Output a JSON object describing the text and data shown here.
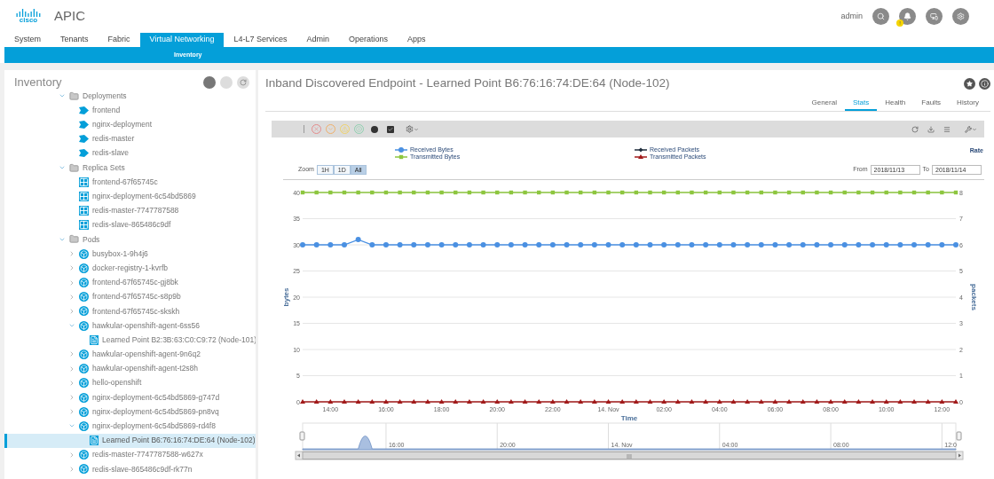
{
  "header": {
    "logo_text": "cisco",
    "app_name": "APIC",
    "user": "admin",
    "notification_badge": "!"
  },
  "tabs": [
    {
      "label": "System",
      "selected": false
    },
    {
      "label": "Tenants",
      "selected": false
    },
    {
      "label": "Fabric",
      "selected": false
    },
    {
      "label": "Virtual Networking",
      "selected": true
    },
    {
      "label": "L4-L7 Services",
      "selected": false
    },
    {
      "label": "Admin",
      "selected": false
    },
    {
      "label": "Operations",
      "selected": false
    },
    {
      "label": "Apps",
      "selected": false
    }
  ],
  "subtabs": [
    {
      "label": "Inventory",
      "selected": true
    }
  ],
  "sidebar": {
    "title": "Inventory",
    "tree": [
      {
        "label": "Deployments",
        "kind": "folder",
        "expanded": true,
        "selected": false,
        "children": [
          {
            "label": "frontend",
            "kind": "deployment",
            "selected": false
          },
          {
            "label": "nginx-deployment",
            "kind": "deployment",
            "selected": false
          },
          {
            "label": "redis-master",
            "kind": "deployment",
            "selected": false
          },
          {
            "label": "redis-slave",
            "kind": "deployment",
            "selected": false
          }
        ]
      },
      {
        "label": "Replica Sets",
        "kind": "folder",
        "expanded": true,
        "selected": false,
        "children": [
          {
            "label": "frontend-67f65745c",
            "kind": "replicaset",
            "selected": false
          },
          {
            "label": "nginx-deployment-6c54bd5869",
            "kind": "replicaset",
            "selected": false
          },
          {
            "label": "redis-master-7747787588",
            "kind": "replicaset",
            "selected": false
          },
          {
            "label": "redis-slave-865486c9df",
            "kind": "replicaset",
            "selected": false
          }
        ]
      },
      {
        "label": "Pods",
        "kind": "folder",
        "expanded": true,
        "selected": false,
        "children": [
          {
            "label": "busybox-1-9h4j6",
            "kind": "pod",
            "expanded": false,
            "selected": false
          },
          {
            "label": "docker-registry-1-kvrfb",
            "kind": "pod",
            "expanded": false,
            "selected": false
          },
          {
            "label": "frontend-67f65745c-gj8bk",
            "kind": "pod",
            "expanded": false,
            "selected": false
          },
          {
            "label": "frontend-67f65745c-s8p9b",
            "kind": "pod",
            "expanded": false,
            "selected": false
          },
          {
            "label": "frontend-67f65745c-skskh",
            "kind": "pod",
            "expanded": false,
            "selected": false
          },
          {
            "label": "hawkular-openshift-agent-6ss56",
            "kind": "pod",
            "expanded": true,
            "selected": false,
            "children": [
              {
                "label": "Learned Point B2:3B:63:C0:C9:72 (Node-101)",
                "kind": "endpoint",
                "selected": false
              }
            ]
          },
          {
            "label": "hawkular-openshift-agent-9n6q2",
            "kind": "pod",
            "expanded": false,
            "selected": false
          },
          {
            "label": "hawkular-openshift-agent-t2s8h",
            "kind": "pod",
            "expanded": false,
            "selected": false
          },
          {
            "label": "hello-openshift",
            "kind": "pod",
            "expanded": false,
            "selected": false
          },
          {
            "label": "nginx-deployment-6c54bd5869-g747d",
            "kind": "pod",
            "expanded": false,
            "selected": false
          },
          {
            "label": "nginx-deployment-6c54bd5869-pn8vq",
            "kind": "pod",
            "expanded": false,
            "selected": false
          },
          {
            "label": "nginx-deployment-6c54bd5869-rd4f8",
            "kind": "pod",
            "expanded": true,
            "selected": false,
            "children": [
              {
                "label": "Learned Point B6:76:16:74:DE:64 (Node-102)",
                "kind": "endpoint",
                "selected": true
              }
            ]
          },
          {
            "label": "redis-master-7747787588-w627x",
            "kind": "pod",
            "expanded": false,
            "selected": false
          },
          {
            "label": "redis-slave-865486c9df-rk77n",
            "kind": "pod",
            "expanded": false,
            "selected": false
          }
        ]
      }
    ]
  },
  "detail": {
    "title": "Inband Discovered Endpoint - Learned Point B6:76:16:74:DE:64 (Node-102)",
    "tabs": [
      {
        "label": "General",
        "selected": false
      },
      {
        "label": "Stats",
        "selected": true
      },
      {
        "label": "Health",
        "selected": false
      },
      {
        "label": "Faults",
        "selected": false
      },
      {
        "label": "History",
        "selected": false
      }
    ],
    "rate_label": "Rate",
    "zoom": {
      "label": "Zoom",
      "options": [
        {
          "label": "1H",
          "selected": false
        },
        {
          "label": "1D",
          "selected": false
        },
        {
          "label": "All",
          "selected": true
        }
      ]
    },
    "from": {
      "label": "From",
      "value": "2018/11/13"
    },
    "to": {
      "label": "To",
      "value": "2018/11/14"
    },
    "chart_data": {
      "type": "line",
      "xlabel": "Time",
      "ylabel": "bytes",
      "x": [
        "2018-11-13 13:00",
        "2018-11-13 13:30",
        "2018-11-13 14:00",
        "2018-11-13 14:30",
        "2018-11-13 15:00",
        "2018-11-13 15:30",
        "2018-11-13 16:00",
        "2018-11-13 16:30",
        "2018-11-13 17:00",
        "2018-11-13 17:30",
        "2018-11-13 18:00",
        "2018-11-13 18:30",
        "2018-11-13 19:00",
        "2018-11-13 19:30",
        "2018-11-13 20:00",
        "2018-11-13 20:30",
        "2018-11-13 21:00",
        "2018-11-13 21:30",
        "2018-11-13 22:00",
        "2018-11-13 22:30",
        "2018-11-13 23:00",
        "2018-11-13 23:30",
        "2018-11-14 00:00",
        "2018-11-14 00:30",
        "2018-11-14 01:00",
        "2018-11-14 01:30",
        "2018-11-14 02:00",
        "2018-11-14 02:30",
        "2018-11-14 03:00",
        "2018-11-14 03:30",
        "2018-11-14 04:00",
        "2018-11-14 04:30",
        "2018-11-14 05:00",
        "2018-11-14 05:30",
        "2018-11-14 06:00",
        "2018-11-14 06:30",
        "2018-11-14 07:00",
        "2018-11-14 07:30",
        "2018-11-14 08:00",
        "2018-11-14 08:30",
        "2018-11-14 09:00",
        "2018-11-14 09:30",
        "2018-11-14 10:00",
        "2018-11-14 10:30",
        "2018-11-14 11:00",
        "2018-11-14 11:30",
        "2018-11-14 12:00",
        "2018-11-14 12:30"
      ],
      "series": [
        {
          "name": "Received Bytes",
          "color": "#4a90e2",
          "marker": "circle",
          "values": [
            30,
            30,
            30,
            30,
            31,
            30,
            30,
            30,
            30,
            30,
            30,
            30,
            30,
            30,
            30,
            30,
            30,
            30,
            30,
            30,
            30,
            30,
            30,
            30,
            30,
            30,
            30,
            30,
            30,
            30,
            30,
            30,
            30,
            30,
            30,
            30,
            30,
            30,
            30,
            30,
            30,
            30,
            30,
            30,
            30,
            30,
            30,
            30
          ]
        },
        {
          "name": "Transmitted Bytes",
          "color": "#8dc63f",
          "marker": "square",
          "values": [
            40,
            40,
            40,
            40,
            40,
            40,
            40,
            40,
            40,
            40,
            40,
            40,
            40,
            40,
            40,
            40,
            40,
            40,
            40,
            40,
            40,
            40,
            40,
            40,
            40,
            40,
            40,
            40,
            40,
            40,
            40,
            40,
            40,
            40,
            40,
            40,
            40,
            40,
            40,
            40,
            40,
            40,
            40,
            40,
            40,
            40,
            40,
            40
          ]
        },
        {
          "name": "Received Packets",
          "color": "#1f2d3d",
          "marker": "diamond",
          "values": [
            null,
            null,
            null,
            null,
            null,
            null,
            null,
            null,
            null,
            null,
            null,
            null,
            null,
            null,
            null,
            null,
            null,
            null,
            null,
            null,
            null,
            null,
            null,
            null,
            null,
            null,
            null,
            null,
            null,
            null,
            null,
            null,
            null,
            null,
            null,
            null,
            null,
            null,
            null,
            null,
            null,
            null,
            null,
            null,
            null,
            null,
            null,
            null
          ]
        },
        {
          "name": "Transmitted Packets",
          "color": "#a11a1a",
          "marker": "triangle",
          "values": [
            0,
            0,
            0,
            0,
            0,
            0,
            0,
            0,
            0,
            0,
            0,
            0,
            0,
            0,
            0,
            0,
            0,
            0,
            0,
            0,
            0,
            0,
            0,
            0,
            0,
            0,
            0,
            0,
            0,
            0,
            0,
            0,
            0,
            0,
            0,
            0,
            0,
            0,
            0,
            0,
            0,
            0,
            0,
            0,
            0,
            0,
            0,
            0
          ]
        }
      ],
      "xlim": [
        "2018-11-13 13:00",
        "2018-11-14 12:30"
      ],
      "ylim": [
        0,
        40
      ],
      "grid": true,
      "xticks": [
        {
          "value": "2018-11-13 14:00",
          "label": "14:00"
        },
        {
          "value": "2018-11-13 16:00",
          "label": "16:00"
        },
        {
          "value": "2018-11-13 18:00",
          "label": "18:00"
        },
        {
          "value": "2018-11-13 20:00",
          "label": "20:00"
        },
        {
          "value": "2018-11-13 22:00",
          "label": "22:00"
        },
        {
          "value": "2018-11-14 00:00",
          "label": "14. Nov"
        },
        {
          "value": "2018-11-14 02:00",
          "label": "02:00"
        },
        {
          "value": "2018-11-14 04:00",
          "label": "04:00"
        },
        {
          "value": "2018-11-14 06:00",
          "label": "06:00"
        },
        {
          "value": "2018-11-14 08:00",
          "label": "08:00"
        },
        {
          "value": "2018-11-14 10:00",
          "label": "10:00"
        },
        {
          "value": "2018-11-14 12:00",
          "label": "12:00"
        }
      ],
      "yticks": [
        0,
        5,
        10,
        15,
        20,
        25,
        30,
        35,
        40
      ]
    },
    "right_axis": {
      "label": "packets",
      "ticks": [
        "8",
        "7",
        "6",
        "5",
        "4",
        "3",
        "2",
        "1",
        "0"
      ]
    },
    "navigator": {
      "labels": [
        "16:00",
        "20:00",
        "14. Nov",
        "04:00",
        "08:00",
        "12:0"
      ],
      "scroll_grip": "III"
    }
  }
}
